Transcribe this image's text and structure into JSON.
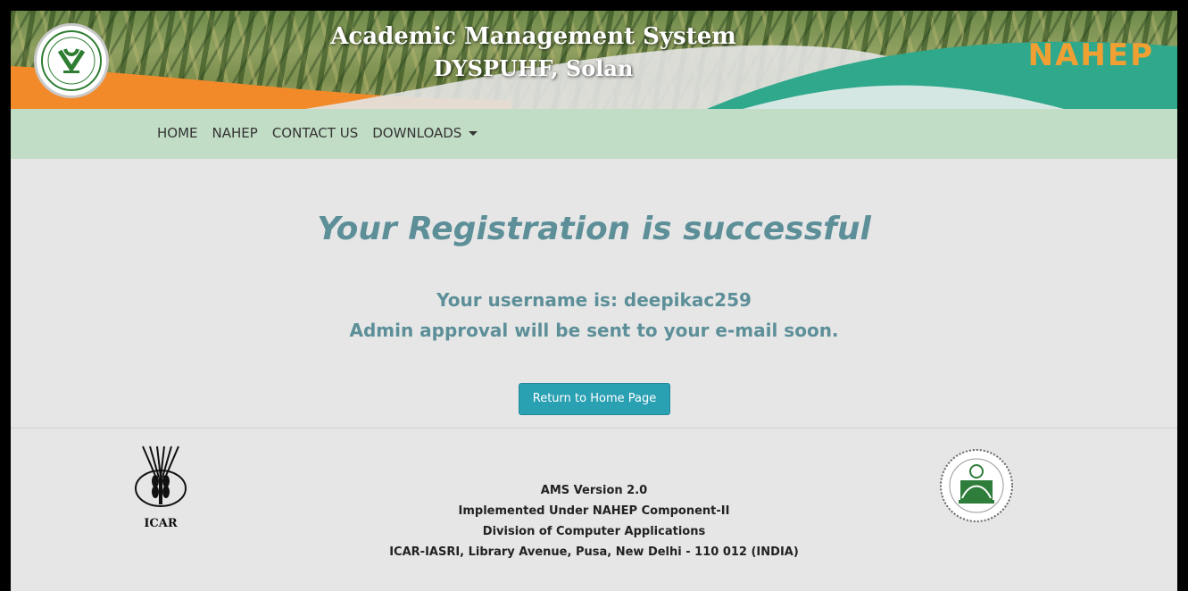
{
  "header": {
    "title": "Academic Management System",
    "subtitle": "DYSPUHF, Solan",
    "left_logo_icon": "university-emblem-icon",
    "right_logo_text": "NAHEP"
  },
  "nav": {
    "items": [
      {
        "label": "HOME"
      },
      {
        "label": "NAHEP"
      },
      {
        "label": "CONTACT US"
      },
      {
        "label": "DOWNLOADS"
      }
    ]
  },
  "main": {
    "headline": "Your Registration is successful",
    "username_line": "Your username is: deepikac259",
    "approval_line": "Admin approval will be sent to your e-mail soon.",
    "return_button_label": "Return to Home Page"
  },
  "footer": {
    "lines": [
      "AMS Version 2.0",
      "Implemented Under NAHEP Component-II",
      "Division of Computer Applications",
      "ICAR-IASRI, Library Avenue, Pusa, New Delhi - 110 012 (INDIA)"
    ],
    "left_logo_text": "ICAR",
    "left_logo_icon": "icar-logo-icon",
    "right_logo_icon": "iasri-seal-icon"
  },
  "colors": {
    "accent": "#5d8f99",
    "button": "#2aa0b3",
    "nav_bg": "#c2ddc6",
    "banner_orange": "#f28a2a",
    "banner_teal": "#2fa88c"
  }
}
